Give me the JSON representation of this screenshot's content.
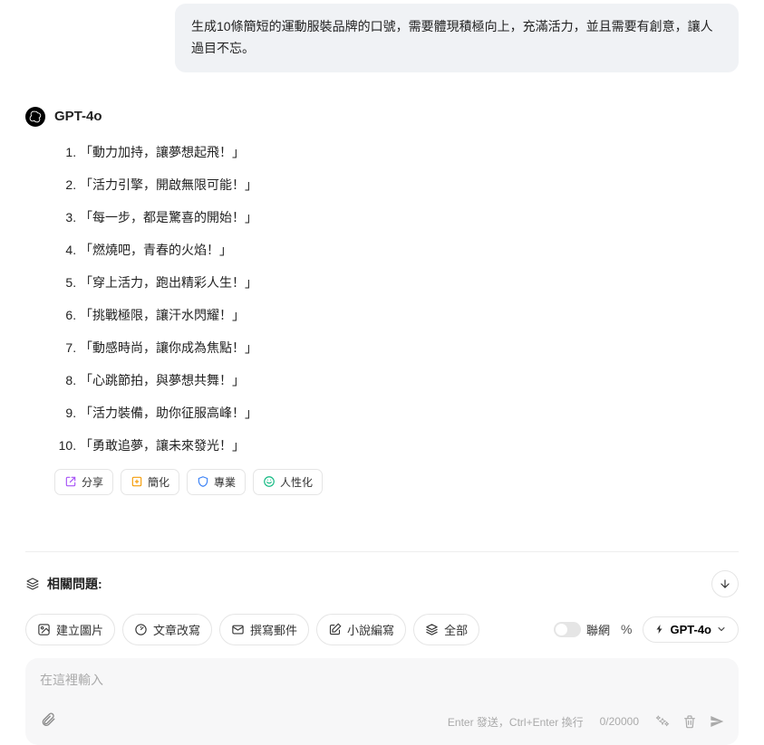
{
  "user_message": "生成10條簡短的運動服裝品牌的口號，需要體現積極向上，充滿活力，並且需要有創意，讓人過目不忘。",
  "model": {
    "name": "GPT-4o"
  },
  "slogans": [
    "「動力加持，讓夢想起飛！」",
    "「活力引擎，開啟無限可能！」",
    "「每一步，都是驚喜的開始！」",
    "「燃燒吧，青春的火焰！」",
    "「穿上活力，跑出精彩人生！」",
    "「挑戰極限，讓汗水閃耀！」",
    "「動感時尚，讓你成為焦點！」",
    "「心跳節拍，與夢想共舞！」",
    "「活力裝備，助你征服高峰！」",
    "「勇敢追夢，讓未來發光！」"
  ],
  "actions": {
    "share": "分享",
    "simplify": "簡化",
    "professional": "專業",
    "humanize": "人性化"
  },
  "related": {
    "title": "相關問題:"
  },
  "tools": {
    "create_image": "建立圖片",
    "rewrite": "文章改寫",
    "email": "撰寫郵件",
    "fiction": "小說編寫",
    "all": "全部",
    "network": "聯網",
    "model_select": "GPT-4o"
  },
  "input": {
    "placeholder": "在這裡輸入",
    "hint": "Enter 發送，Ctrl+Enter 換行",
    "counter": "0/20000"
  }
}
